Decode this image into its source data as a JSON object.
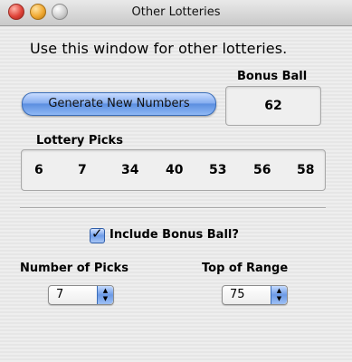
{
  "window": {
    "title": "Other Lotteries"
  },
  "headline": "Use this window for other lotteries.",
  "bonus": {
    "label": "Bonus Ball",
    "value": "62"
  },
  "generate_button": "Generate New Numbers",
  "picks": {
    "label": "Lottery Picks",
    "values": [
      "6",
      "7",
      "34",
      "40",
      "53",
      "56",
      "58"
    ]
  },
  "include_bonus": {
    "label": "Include Bonus Ball?",
    "checked": true
  },
  "number_of_picks": {
    "label": "Number of Picks",
    "value": "7"
  },
  "top_of_range": {
    "label": "Top of Range",
    "value": "75"
  },
  "icons": {
    "close": "close-icon",
    "minimize": "minimize-icon",
    "zoom": "zoom-icon",
    "checkmark": "checkmark-icon",
    "popup": "up-down-arrows-icon"
  }
}
